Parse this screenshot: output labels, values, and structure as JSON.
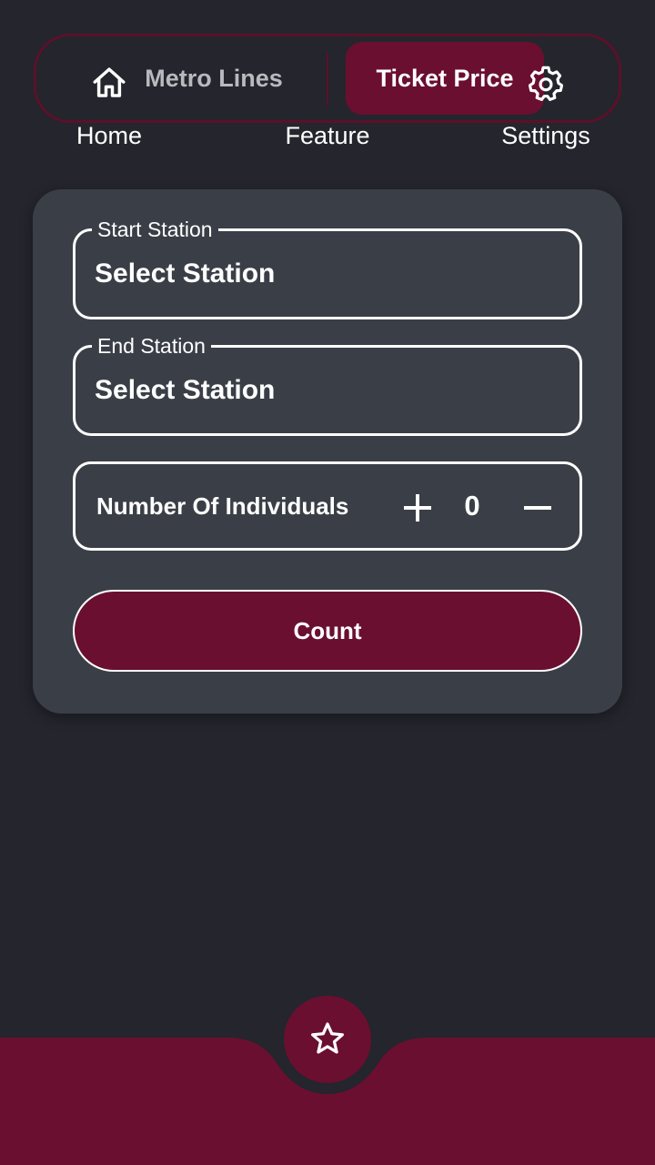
{
  "tabs": {
    "metro_lines": "Metro Lines",
    "ticket_price": "Ticket Price",
    "active": "ticket_price"
  },
  "form": {
    "start_station": {
      "label": "Start Station",
      "value": "Select Station"
    },
    "end_station": {
      "label": "End Station",
      "value": "Select Station"
    },
    "individuals": {
      "label": "Number Of Individuals",
      "value": "0"
    },
    "count_button": "Count"
  },
  "nav": {
    "home": {
      "label": "Home",
      "icon": "home-icon"
    },
    "feature": {
      "label": "Feature",
      "icon": "star-icon"
    },
    "settings": {
      "label": "Settings",
      "icon": "gear-icon"
    }
  },
  "colors": {
    "background": "#24252d",
    "card": "#3a3f47",
    "accent": "#6a0f2f",
    "tab_border": "#5c1029",
    "text": "#ffffff",
    "inactive_text": "#b9b9be"
  }
}
